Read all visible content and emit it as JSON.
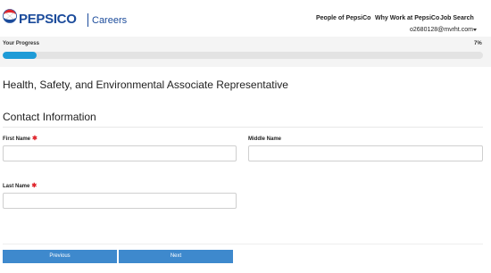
{
  "header": {
    "brand": "PEPSICO",
    "subbrand": "Careers",
    "nav": [
      {
        "label": "People of PepsiCo"
      },
      {
        "label": "Why Work at PepsiCo"
      },
      {
        "label": "Job Search"
      }
    ],
    "user_email": "o2680128@mvrht.com"
  },
  "progress": {
    "label": "Your Progress",
    "percent_text": "7%",
    "fraction": 0.07
  },
  "job_title": "Health, Safety, and Environmental Associate Representative",
  "section": {
    "title": "Contact Information"
  },
  "fields": {
    "first_name": {
      "label": "First Name",
      "required_mark": "✱",
      "value": ""
    },
    "middle_name": {
      "label": "Middle Name",
      "value": ""
    },
    "last_name": {
      "label": "Last Name",
      "required_mark": "✱",
      "value": ""
    }
  },
  "buttons": {
    "previous": "Previous",
    "next": "Next"
  },
  "colors": {
    "brand_blue": "#1b4b9b",
    "progress_fill": "#1e9bd7",
    "button_blue": "#3e89cd",
    "required_red": "#e0262d"
  }
}
